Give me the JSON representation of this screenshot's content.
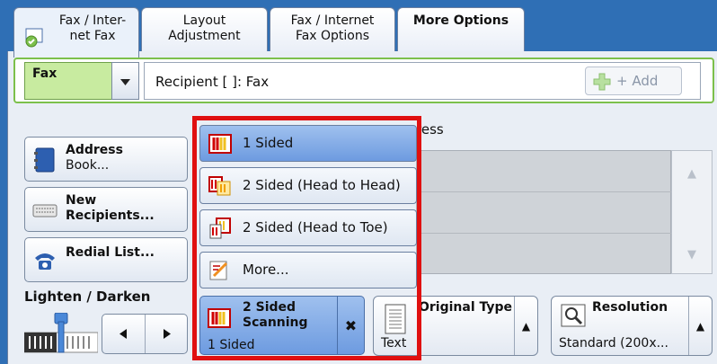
{
  "tabs": [
    {
      "label_line1": "Fax / Inter-",
      "label_line2": "net Fax"
    },
    {
      "label_line1": "Layout",
      "label_line2": "Adjustment"
    },
    {
      "label_line1": "Fax / Internet",
      "label_line2": "Fax Options"
    },
    {
      "label_line1": "More Options",
      "label_line2": ""
    }
  ],
  "fax": {
    "type_value": "Fax",
    "recipient_text": "Recipient [   ]: Fax",
    "add_button": "+ Add"
  },
  "left_buttons": {
    "address_line1": "Address",
    "address_line2": "Book...",
    "new_line1": "New",
    "new_line2": "Recipients...",
    "redial": "Redial List..."
  },
  "lighten_darken": {
    "label": "Lighten / Darken"
  },
  "background": {
    "partial_text": "ress"
  },
  "menu": {
    "items": [
      "1 Sided",
      "2 Sided (Head to Head)",
      "2 Sided (Head to Toe)",
      "More..."
    ],
    "selected_index": 0
  },
  "scan_button": {
    "line1": "2 Sided",
    "line2": "Scanning",
    "value": "1 Sided",
    "clear": "✖"
  },
  "original_type": {
    "label": "Original Type",
    "value": "Text"
  },
  "resolution": {
    "label": "Resolution",
    "value": "Standard (200x..."
  },
  "colors": {
    "accent": "#6d9be0",
    "highlight_frame": "#e01010",
    "fax_green": "#c8eba0"
  }
}
